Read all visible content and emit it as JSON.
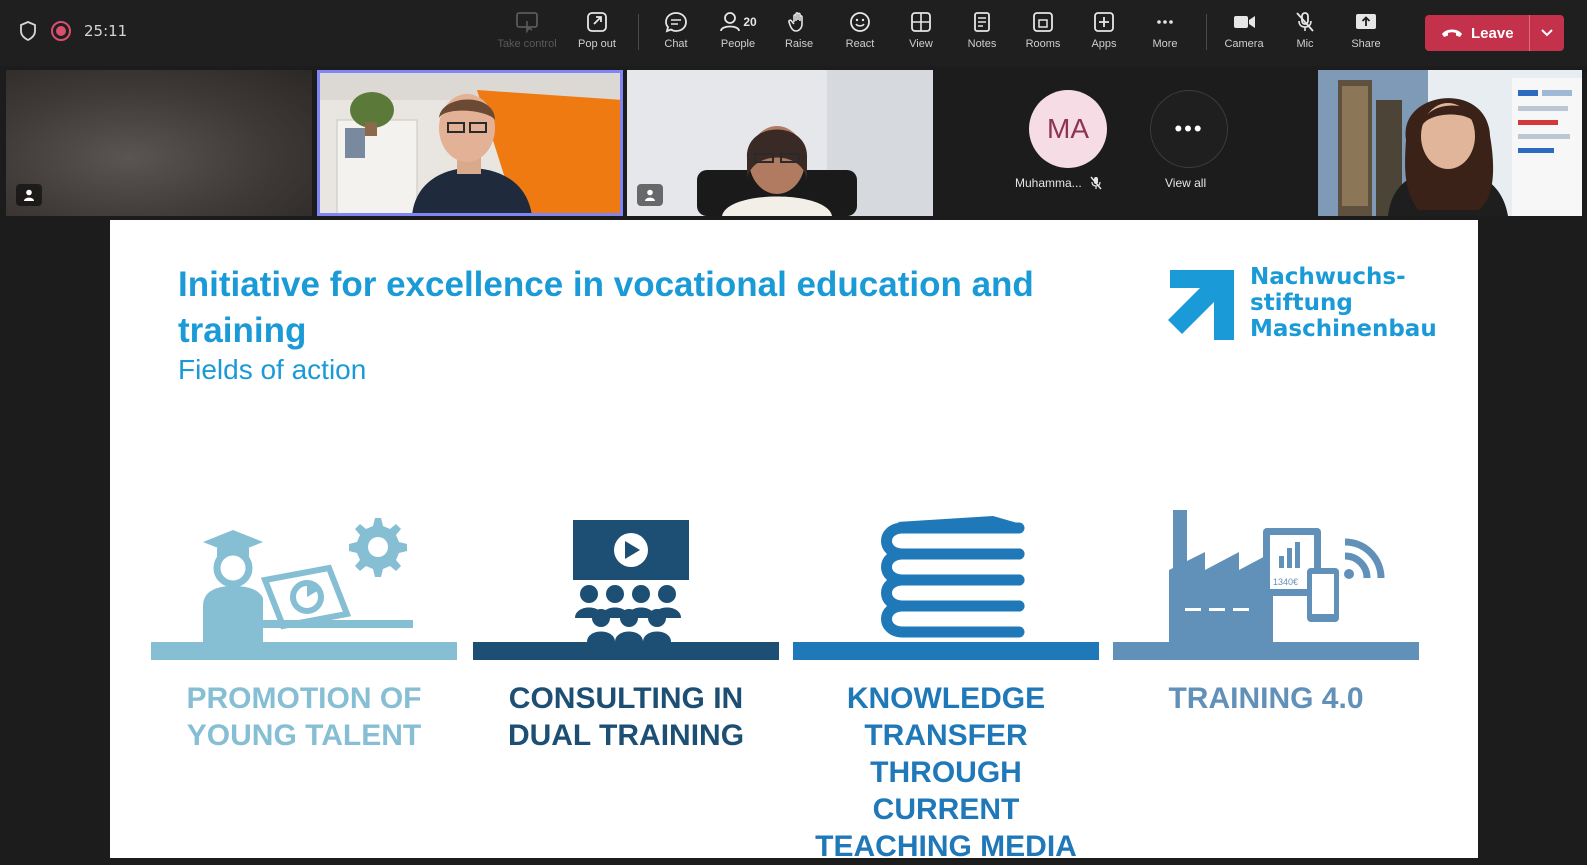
{
  "toolbar": {
    "timer": "25:11",
    "items": [
      {
        "label": "Take control"
      },
      {
        "label": "Pop out"
      },
      {
        "label": "Chat"
      },
      {
        "label": "People",
        "count": "20"
      },
      {
        "label": "Raise"
      },
      {
        "label": "React"
      },
      {
        "label": "View"
      },
      {
        "label": "Notes"
      },
      {
        "label": "Rooms"
      },
      {
        "label": "Apps"
      },
      {
        "label": "More"
      },
      {
        "label": "Camera"
      },
      {
        "label": "Mic"
      },
      {
        "label": "Share"
      }
    ],
    "leave_label": "Leave"
  },
  "gallery": {
    "avatar_initials": "MA",
    "avatar_name": "Muhamma...",
    "view_all_label": "View all"
  },
  "slide": {
    "title": "Initiative for excellence in vocational education and training",
    "subtitle": "Fields of action",
    "logo_text": "Nachwuchs-\nstiftung\nMaschinenbau",
    "factory_screen_text": "1340€",
    "fields": [
      {
        "label": "PROMOTION OF YOUNG TALENT",
        "color": "#86bed4"
      },
      {
        "label": "CONSULTING IN DUAL TRAINING",
        "color": "#1d4f74"
      },
      {
        "label": "KNOWLEDGE TRANSFER THROUGH CURRENT TEACHING MEDIA",
        "color": "#1f78b8"
      },
      {
        "label": "TRAINING 4.0",
        "color": "#6190b8"
      }
    ]
  },
  "colors": {
    "leave": "#c4314b",
    "accent": "#1a9ad6",
    "active_speaker": "#7f85f5"
  }
}
